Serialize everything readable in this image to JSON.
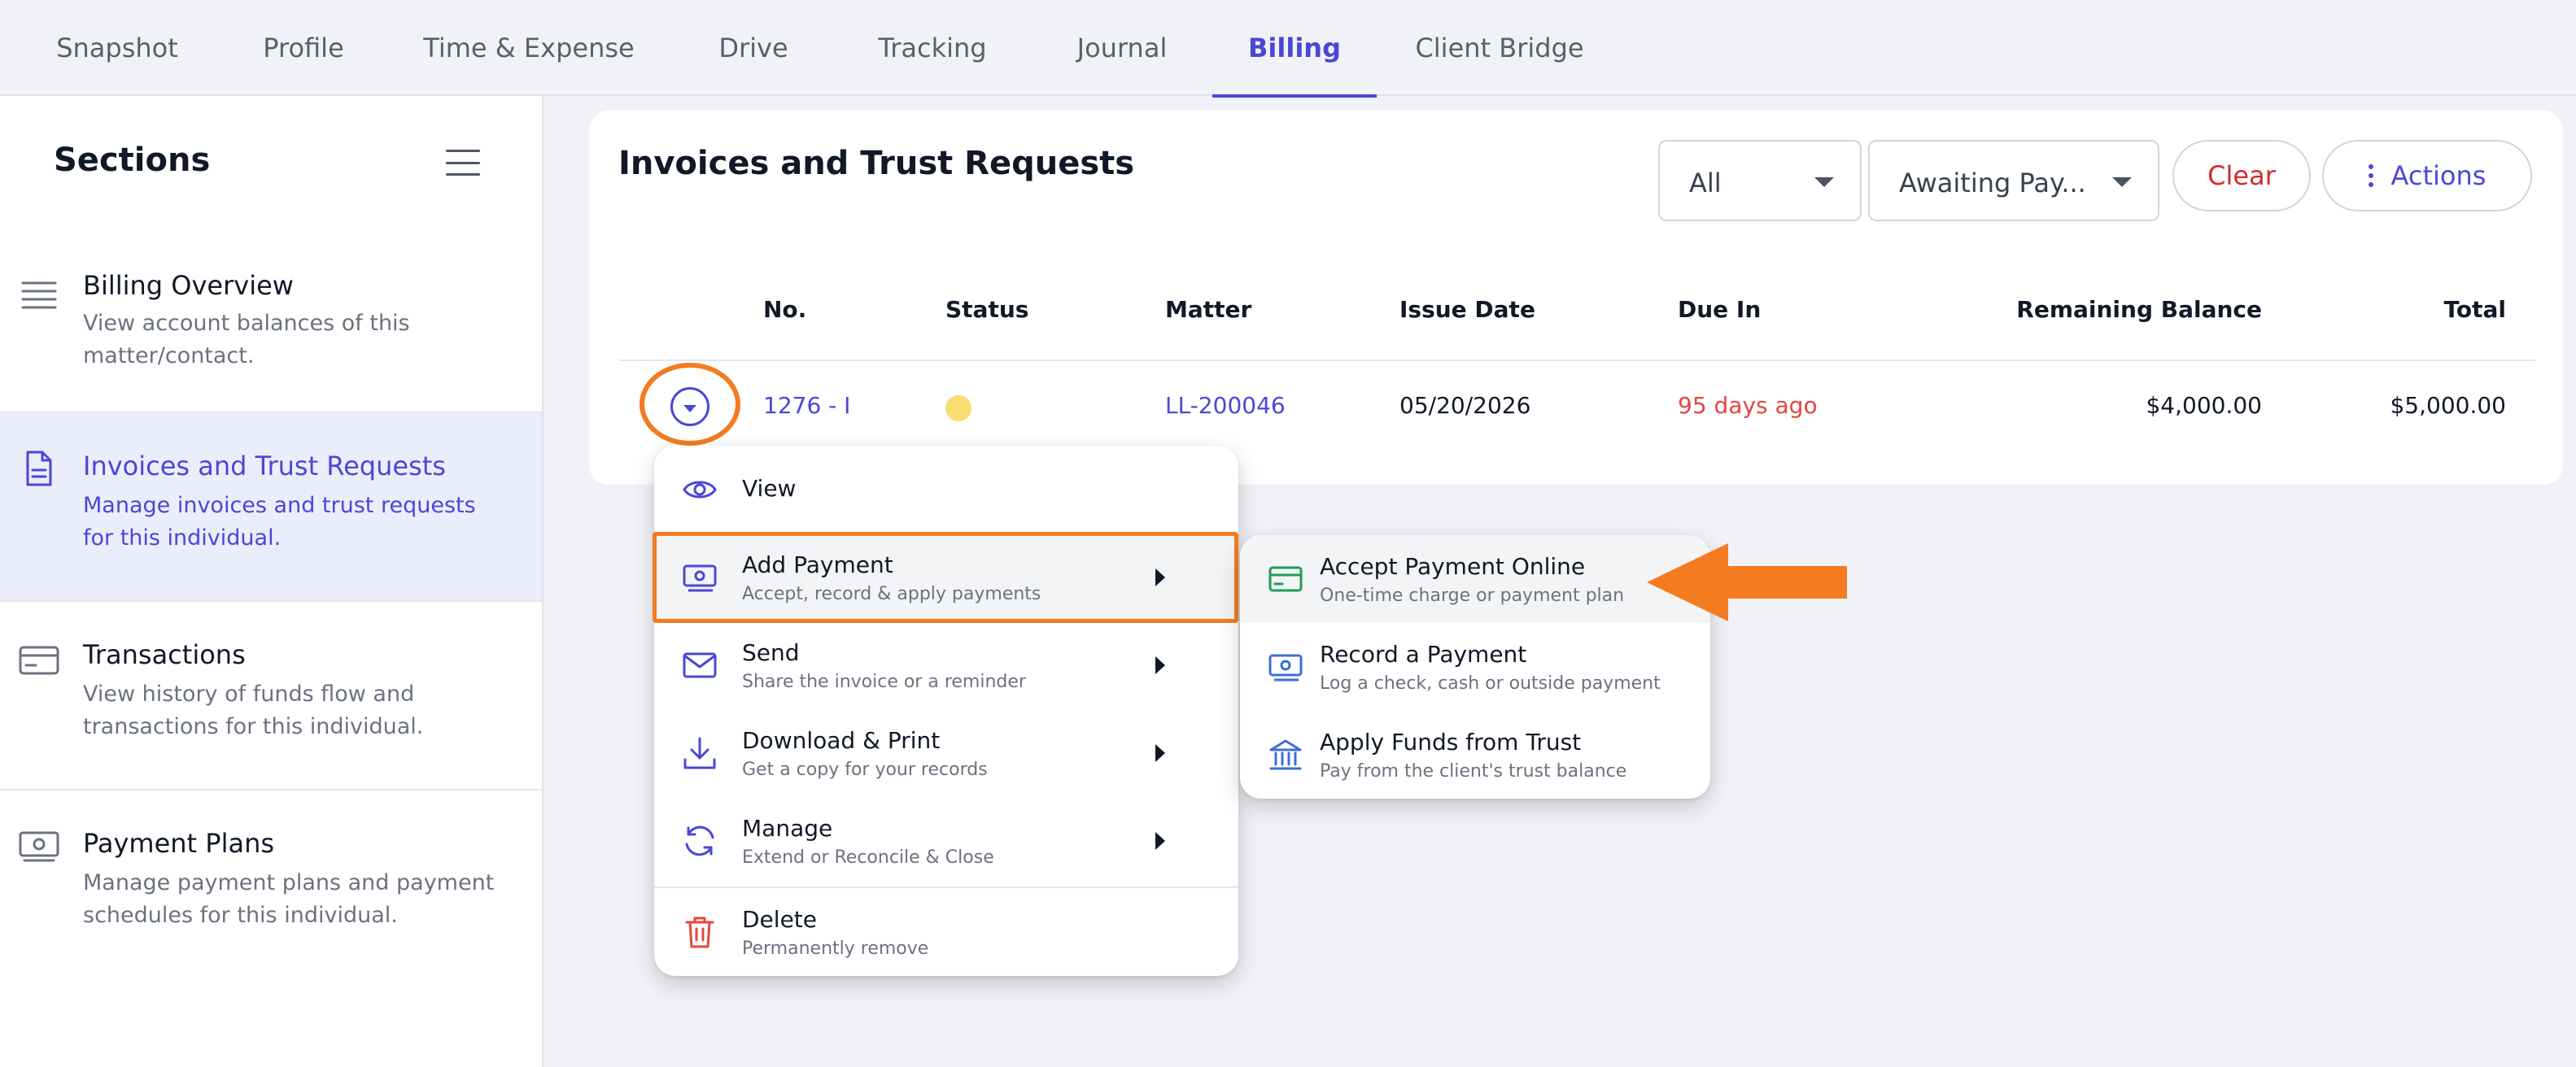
{
  "tabs": [
    {
      "label": "Snapshot",
      "active": false
    },
    {
      "label": "Profile",
      "active": false
    },
    {
      "label": "Time & Expense",
      "active": false
    },
    {
      "label": "Drive",
      "active": false
    },
    {
      "label": "Tracking",
      "active": false
    },
    {
      "label": "Journal",
      "active": false
    },
    {
      "label": "Billing",
      "active": true
    },
    {
      "label": "Client Bridge",
      "active": false
    }
  ],
  "sidebar": {
    "title": "Sections",
    "items": [
      {
        "title": "Billing Overview",
        "desc": "View account balances of this matter/contact.",
        "icon": "list-lines-icon",
        "active": false
      },
      {
        "title": "Invoices and Trust Requests",
        "desc": "Manage invoices and trust requests for this individual.",
        "icon": "document-icon",
        "active": true
      },
      {
        "title": "Transactions",
        "desc": "View history of funds flow and transactions for this individual.",
        "icon": "card-icon",
        "active": false
      },
      {
        "title": "Payment Plans",
        "desc": "Manage payment plans and payment schedules for this individual.",
        "icon": "cash-icon",
        "active": false
      }
    ]
  },
  "main": {
    "title": "Invoices and Trust Requests",
    "filters": {
      "type": "All",
      "status": "Awaiting Pay..."
    },
    "clear_label": "Clear",
    "actions_label": "Actions",
    "columns": {
      "no": "No.",
      "status": "Status",
      "matter": "Matter",
      "issue_date": "Issue Date",
      "due_in": "Due In",
      "remaining_balance": "Remaining Balance",
      "total": "Total"
    },
    "rows": [
      {
        "no": "1276 - I",
        "status_color": "#f8dd72",
        "matter": "LL-200046",
        "issue_date": "05/20/2026",
        "due_in": "95 days ago",
        "remaining_balance": "$4,000.00",
        "total": "$5,000.00"
      }
    ]
  },
  "context_menu": {
    "items": [
      {
        "title": "View",
        "subtitle": "",
        "icon": "eye-icon",
        "submenu": false
      },
      {
        "title": "Add Payment",
        "subtitle": "Accept, record & apply payments",
        "icon": "cash-icon",
        "submenu": true,
        "highlighted": true
      },
      {
        "title": "Send",
        "subtitle": "Share the invoice or a reminder",
        "icon": "envelope-icon",
        "submenu": true
      },
      {
        "title": "Download & Print",
        "subtitle": "Get a copy for your records",
        "icon": "download-icon",
        "submenu": true
      },
      {
        "title": "Manage",
        "subtitle": "Extend or Reconcile & Close",
        "icon": "refresh-icon",
        "submenu": true
      },
      {
        "title": "Delete",
        "subtitle": "Permanently remove",
        "icon": "trash-icon",
        "submenu": false
      }
    ]
  },
  "submenu": {
    "items": [
      {
        "title": "Accept Payment Online",
        "subtitle": "One-time charge or payment plan",
        "icon": "credit-card-icon",
        "icon_color": "#1f9d55",
        "hovered": true
      },
      {
        "title": "Record a Payment",
        "subtitle": "Log a check, cash or outside payment",
        "icon": "cash-icon",
        "icon_color": "#3b6fd8"
      },
      {
        "title": "Apply Funds from Trust",
        "subtitle": "Pay from the client's trust balance",
        "icon": "bank-icon",
        "icon_color": "#3b6fd8"
      }
    ]
  },
  "colors": {
    "accent": "#4b47d6",
    "highlight": "#f47b20",
    "danger": "#d52b2b",
    "overdue": "#e3463f",
    "background": "#f0f2f7"
  }
}
